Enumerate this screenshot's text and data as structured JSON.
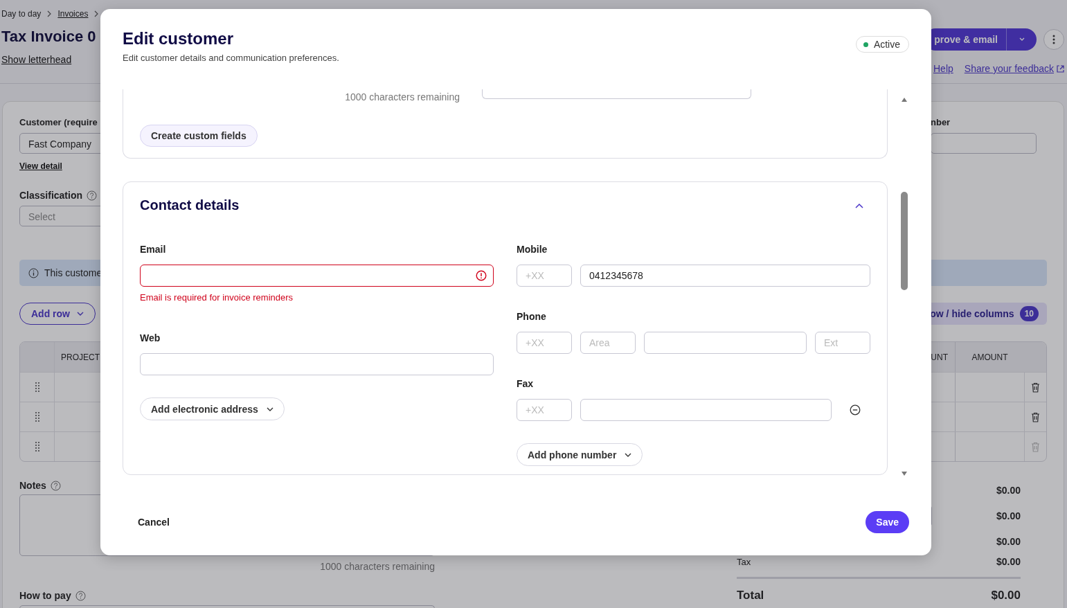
{
  "background_page": {
    "breadcrumb": [
      "Day to day",
      "Invoices"
    ],
    "title": "Tax Invoice 0",
    "show_letterhead": "Show letterhead",
    "primary_action": "prove & email",
    "help_link": "Help",
    "feedback_link": "Share your feedback",
    "customer": {
      "label": "Customer (require",
      "value": "Fast Company",
      "view_detail": "View detail"
    },
    "number_label": "nber",
    "classification": {
      "label": "Classification",
      "placeholder": "Select"
    },
    "info_banner": "This custome",
    "add_row": "Add row",
    "columns_button": {
      "label": "ow / hide columns",
      "count": "10"
    },
    "table": {
      "columns": [
        "PROJECT",
        "UNT",
        "AMOUNT"
      ],
      "rows": [
        {
          "delete_disabled": false
        },
        {
          "delete_disabled": false
        },
        {
          "delete_disabled": true
        }
      ]
    },
    "notes": {
      "label": "Notes",
      "counter": "1000 characters remaining"
    },
    "how_to_pay": {
      "label": "How to pay"
    },
    "totals": [
      {
        "kind": "plain",
        "value": "$0.00"
      },
      {
        "kind": "input",
        "value": "$0.00"
      },
      {
        "kind": "plain",
        "value": "$0.00"
      },
      {
        "kind": "labelled",
        "label": "Tax",
        "value": "$0.00"
      },
      {
        "kind": "total",
        "label": "Total",
        "value": "$0.00"
      }
    ]
  },
  "modal": {
    "title": "Edit customer",
    "subtitle": "Edit customer details and communication preferences.",
    "status": "Active",
    "custom_fields": {
      "counter": "1000 characters remaining",
      "button": "Create custom fields"
    },
    "contact": {
      "title": "Contact details",
      "expanded": true,
      "email": {
        "label": "Email",
        "error": "Email is required for invoice reminders"
      },
      "web": {
        "label": "Web"
      },
      "add_address": "Add electronic address",
      "phones": [
        {
          "kind": "mobile",
          "label": "Mobile",
          "country_placeholder": "+XX",
          "number": "0412345678"
        },
        {
          "kind": "phone",
          "label": "Phone",
          "country_placeholder": "+XX",
          "area_placeholder": "Area",
          "ext_placeholder": "Ext"
        },
        {
          "kind": "fax",
          "label": "Fax",
          "country_placeholder": "+XX",
          "removable": true
        }
      ],
      "add_phone": "Add phone number"
    },
    "cancel": "Cancel",
    "save": "Save"
  }
}
